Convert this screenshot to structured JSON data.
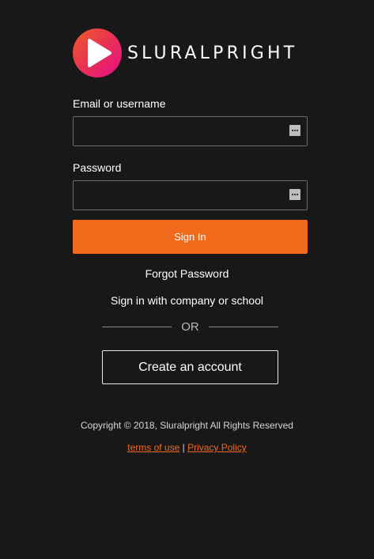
{
  "brand": {
    "name": "SLURALPRIGHT",
    "logo_icon": "play-icon",
    "gradient_colors": [
      "#f15b2a",
      "#e8364f",
      "#e80a89"
    ]
  },
  "form": {
    "email_label": "Email or username",
    "email_value": "",
    "password_label": "Password",
    "password_value": "",
    "field_icon": "password-manager-key-icon",
    "signin_label": "Sign In",
    "signin_color": "#f26a1b"
  },
  "links": {
    "forgot_password": "Forgot Password",
    "company_signin": "Sign in with company or school",
    "divider_text": "OR",
    "create_account": "Create an account"
  },
  "footer": {
    "copyright": "Copyright © 2018, Sluralpright All Rights Reserved",
    "terms": "terms of use",
    "separator": "|",
    "privacy": "Privacy Policy",
    "link_color": "#f26a1b"
  }
}
